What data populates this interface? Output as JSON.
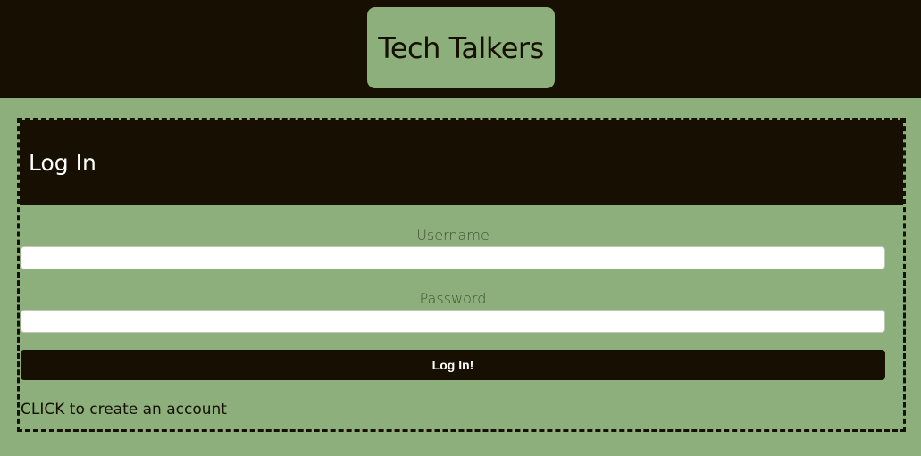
{
  "app": {
    "title": "Tech Talkers"
  },
  "login": {
    "heading": "Log In",
    "username_label": "Username",
    "username_value": "",
    "password_label": "Password",
    "password_value": "",
    "submit_label": "Log In!",
    "signup_link": "CLICK to create an account"
  },
  "colors": {
    "dark": "#160f02",
    "green": "#8caf7b",
    "white": "#ffffff"
  }
}
